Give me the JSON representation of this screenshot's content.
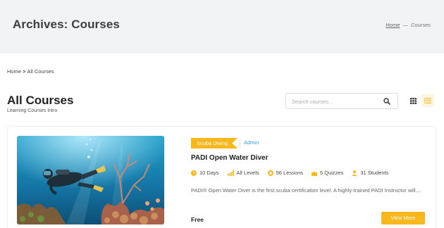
{
  "header": {
    "title": "Archives: Courses",
    "breadcrumb_home": "Home",
    "breadcrumb_separator": "—",
    "breadcrumb_current": "Courses"
  },
  "breadcrumb": {
    "home": "Home",
    "separator": ">",
    "current": "All Courses"
  },
  "page": {
    "title": "All Courses",
    "subtitle": "Learning Courses Intro"
  },
  "search": {
    "placeholder": "Search courses...",
    "icon": "search-icon"
  },
  "view_toggle": {
    "grid_icon": "grid-view-icon",
    "list_icon": "list-view-icon",
    "active": "list"
  },
  "course": {
    "category": "Scuba Diving",
    "author": "Admin",
    "title": "PADI Open Water Diver",
    "duration": "10 Days",
    "level": "All Levels",
    "lessons": "56 Lessons",
    "quizzes": "5 Quizzes",
    "students": "31 Students",
    "excerpt": "PADI® Open Water Diver is the first scuba certification level. A highly-trained PADI Instructor will....",
    "price": "Free",
    "button_label": "View More"
  },
  "colors": {
    "accent": "#f7b71d",
    "link": "#2ea3f2",
    "hero_bg": "#f1f3f5"
  }
}
